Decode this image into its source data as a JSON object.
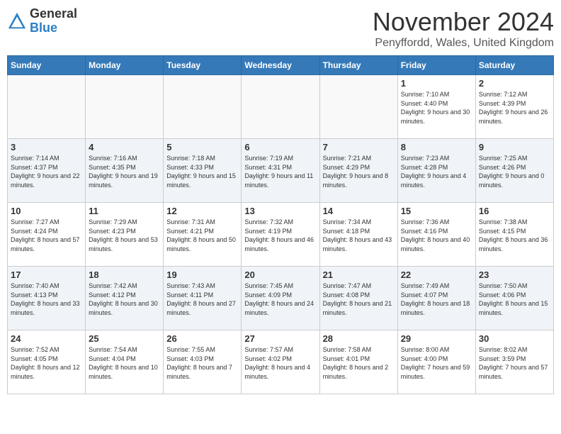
{
  "header": {
    "logo_general": "General",
    "logo_blue": "Blue",
    "month_title": "November 2024",
    "location": "Penyffordd, Wales, United Kingdom"
  },
  "days_of_week": [
    "Sunday",
    "Monday",
    "Tuesday",
    "Wednesday",
    "Thursday",
    "Friday",
    "Saturday"
  ],
  "weeks": [
    [
      {
        "day": "",
        "info": ""
      },
      {
        "day": "",
        "info": ""
      },
      {
        "day": "",
        "info": ""
      },
      {
        "day": "",
        "info": ""
      },
      {
        "day": "",
        "info": ""
      },
      {
        "day": "1",
        "info": "Sunrise: 7:10 AM\nSunset: 4:40 PM\nDaylight: 9 hours\nand 30 minutes."
      },
      {
        "day": "2",
        "info": "Sunrise: 7:12 AM\nSunset: 4:39 PM\nDaylight: 9 hours\nand 26 minutes."
      }
    ],
    [
      {
        "day": "3",
        "info": "Sunrise: 7:14 AM\nSunset: 4:37 PM\nDaylight: 9 hours\nand 22 minutes."
      },
      {
        "day": "4",
        "info": "Sunrise: 7:16 AM\nSunset: 4:35 PM\nDaylight: 9 hours\nand 19 minutes."
      },
      {
        "day": "5",
        "info": "Sunrise: 7:18 AM\nSunset: 4:33 PM\nDaylight: 9 hours\nand 15 minutes."
      },
      {
        "day": "6",
        "info": "Sunrise: 7:19 AM\nSunset: 4:31 PM\nDaylight: 9 hours\nand 11 minutes."
      },
      {
        "day": "7",
        "info": "Sunrise: 7:21 AM\nSunset: 4:29 PM\nDaylight: 9 hours\nand 8 minutes."
      },
      {
        "day": "8",
        "info": "Sunrise: 7:23 AM\nSunset: 4:28 PM\nDaylight: 9 hours\nand 4 minutes."
      },
      {
        "day": "9",
        "info": "Sunrise: 7:25 AM\nSunset: 4:26 PM\nDaylight: 9 hours\nand 0 minutes."
      }
    ],
    [
      {
        "day": "10",
        "info": "Sunrise: 7:27 AM\nSunset: 4:24 PM\nDaylight: 8 hours\nand 57 minutes."
      },
      {
        "day": "11",
        "info": "Sunrise: 7:29 AM\nSunset: 4:23 PM\nDaylight: 8 hours\nand 53 minutes."
      },
      {
        "day": "12",
        "info": "Sunrise: 7:31 AM\nSunset: 4:21 PM\nDaylight: 8 hours\nand 50 minutes."
      },
      {
        "day": "13",
        "info": "Sunrise: 7:32 AM\nSunset: 4:19 PM\nDaylight: 8 hours\nand 46 minutes."
      },
      {
        "day": "14",
        "info": "Sunrise: 7:34 AM\nSunset: 4:18 PM\nDaylight: 8 hours\nand 43 minutes."
      },
      {
        "day": "15",
        "info": "Sunrise: 7:36 AM\nSunset: 4:16 PM\nDaylight: 8 hours\nand 40 minutes."
      },
      {
        "day": "16",
        "info": "Sunrise: 7:38 AM\nSunset: 4:15 PM\nDaylight: 8 hours\nand 36 minutes."
      }
    ],
    [
      {
        "day": "17",
        "info": "Sunrise: 7:40 AM\nSunset: 4:13 PM\nDaylight: 8 hours\nand 33 minutes."
      },
      {
        "day": "18",
        "info": "Sunrise: 7:42 AM\nSunset: 4:12 PM\nDaylight: 8 hours\nand 30 minutes."
      },
      {
        "day": "19",
        "info": "Sunrise: 7:43 AM\nSunset: 4:11 PM\nDaylight: 8 hours\nand 27 minutes."
      },
      {
        "day": "20",
        "info": "Sunrise: 7:45 AM\nSunset: 4:09 PM\nDaylight: 8 hours\nand 24 minutes."
      },
      {
        "day": "21",
        "info": "Sunrise: 7:47 AM\nSunset: 4:08 PM\nDaylight: 8 hours\nand 21 minutes."
      },
      {
        "day": "22",
        "info": "Sunrise: 7:49 AM\nSunset: 4:07 PM\nDaylight: 8 hours\nand 18 minutes."
      },
      {
        "day": "23",
        "info": "Sunrise: 7:50 AM\nSunset: 4:06 PM\nDaylight: 8 hours\nand 15 minutes."
      }
    ],
    [
      {
        "day": "24",
        "info": "Sunrise: 7:52 AM\nSunset: 4:05 PM\nDaylight: 8 hours\nand 12 minutes."
      },
      {
        "day": "25",
        "info": "Sunrise: 7:54 AM\nSunset: 4:04 PM\nDaylight: 8 hours\nand 10 minutes."
      },
      {
        "day": "26",
        "info": "Sunrise: 7:55 AM\nSunset: 4:03 PM\nDaylight: 8 hours\nand 7 minutes."
      },
      {
        "day": "27",
        "info": "Sunrise: 7:57 AM\nSunset: 4:02 PM\nDaylight: 8 hours\nand 4 minutes."
      },
      {
        "day": "28",
        "info": "Sunrise: 7:58 AM\nSunset: 4:01 PM\nDaylight: 8 hours\nand 2 minutes."
      },
      {
        "day": "29",
        "info": "Sunrise: 8:00 AM\nSunset: 4:00 PM\nDaylight: 7 hours\nand 59 minutes."
      },
      {
        "day": "30",
        "info": "Sunrise: 8:02 AM\nSunset: 3:59 PM\nDaylight: 7 hours\nand 57 minutes."
      }
    ]
  ]
}
